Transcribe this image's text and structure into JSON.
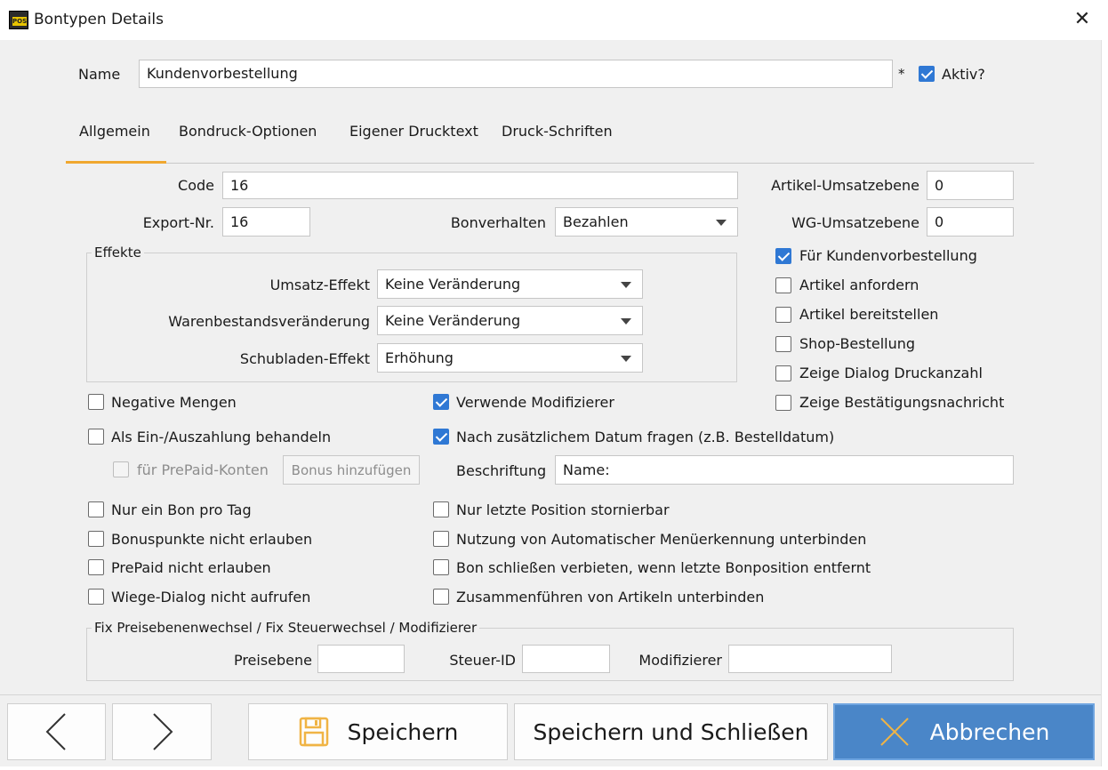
{
  "window": {
    "title": "Bontypen Details",
    "app_badge": "POS"
  },
  "header": {
    "name_label": "Name",
    "name_value": "Kundenvorbestellung",
    "required_marker": "*",
    "active_label": "Aktiv?",
    "active_checked": true
  },
  "tabs": [
    "Allgemein",
    "Bondruck-Optionen",
    "Eigener Drucktext",
    "Druck-Schriften"
  ],
  "general": {
    "code_label": "Code",
    "code_value": "16",
    "export_label": "Export-Nr.",
    "export_value": "16",
    "bonverhalten_label": "Bonverhalten",
    "bonverhalten_value": "Bezahlen",
    "artikel_umsatz_label": "Artikel-Umsatzebene",
    "artikel_umsatz_value": "0",
    "wg_umsatz_label": "WG-Umsatzebene",
    "wg_umsatz_value": "0"
  },
  "effects": {
    "title": "Effekte",
    "umsatz_label": "Umsatz-Effekt",
    "umsatz_value": "Keine Veränderung",
    "waren_label": "Warenbestandsveränderung",
    "waren_value": "Keine Veränderung",
    "schub_label": "Schubladen-Effekt",
    "schub_value": "Erhöhung"
  },
  "right_checks": [
    {
      "label": "Für Kundenvorbestellung",
      "checked": true
    },
    {
      "label": "Artikel anfordern",
      "checked": false
    },
    {
      "label": "Artikel bereitstellen",
      "checked": false
    },
    {
      "label": "Shop-Bestellung",
      "checked": false
    },
    {
      "label": "Zeige Dialog Druckanzahl",
      "checked": false
    },
    {
      "label": "Zeige Bestätigungsnachricht",
      "checked": false
    }
  ],
  "left_checks_top": [
    {
      "label": "Negative Mengen",
      "checked": false
    },
    {
      "label": "Als Ein-/Auszahlung behandeln",
      "checked": false
    }
  ],
  "prepaid": {
    "label": "für PrePaid-Konten",
    "checked": false,
    "bonus_button": "Bonus hinzufügen"
  },
  "mid_checks_top": [
    {
      "label": "Verwende Modifizierer",
      "checked": true
    },
    {
      "label": "Nach zusätzlichem Datum fragen (z.B. Bestelldatum)",
      "checked": true
    }
  ],
  "caption": {
    "label": "Beschriftung",
    "value": "Name:"
  },
  "left_checks_bottom": [
    {
      "label": "Nur ein Bon pro Tag",
      "checked": false
    },
    {
      "label": "Bonuspunkte nicht erlauben",
      "checked": false
    },
    {
      "label": "PrePaid nicht erlauben",
      "checked": false
    },
    {
      "label": "Wiege-Dialog nicht aufrufen",
      "checked": false
    }
  ],
  "mid_checks_bottom": [
    {
      "label": "Nur letzte Position stornierbar",
      "checked": false
    },
    {
      "label": "Nutzung von Automatischer Menüerkennung unterbinden",
      "checked": false
    },
    {
      "label": "Bon schließen verbieten, wenn letzte Bonposition entfernt",
      "checked": false
    },
    {
      "label": "Zusammenführen von Artikeln unterbinden",
      "checked": false
    }
  ],
  "fix": {
    "title": "Fix Preisebenenwechsel / Fix Steuerwechsel / Modifizierer",
    "preis_label": "Preisebene",
    "preis_value": "",
    "steuer_label": "Steuer-ID",
    "steuer_value": "",
    "mod_label": "Modifizierer",
    "mod_value": ""
  },
  "footer": {
    "prev": "‹",
    "next": "›",
    "save": "Speichern",
    "save_close": "Speichern und Schließen",
    "cancel": "Abbrechen"
  },
  "colors": {
    "accent": "#2f78d4",
    "tab_underline": "#f0a830",
    "primary_button": "#4a86c8",
    "save_icon": "#f0b445"
  }
}
